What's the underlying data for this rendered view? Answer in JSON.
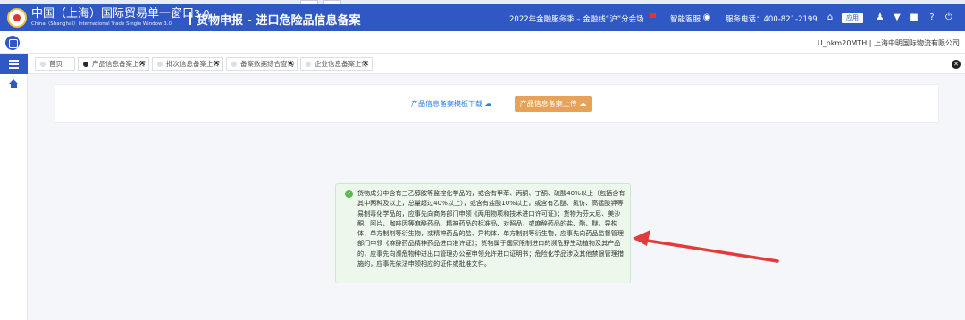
{
  "header": {
    "brand_cn": "中国（上海）国际贸易单一窗口",
    "brand_version": "3.0",
    "brand_en": "China（ShanghaI）International Trade Single Window 3.0",
    "title": "货物申报 - 进口危险品信息备案",
    "promo_text": "2022年金融服务季 – 金融线“沪”分会场",
    "assistant_label": "智能客服",
    "hotline": "服务电话：400-821-2199",
    "apps_label": "应用"
  },
  "subbar": {
    "user": "U_nkm20MTH | 上海中明国际物流有限公司"
  },
  "tabs": [
    {
      "label": "首页",
      "active": false,
      "closable": false
    },
    {
      "label": "产品信息备案上传",
      "active": true,
      "closable": true
    },
    {
      "label": "批次信息备案上传",
      "active": false,
      "closable": true
    },
    {
      "label": "备案数据综合查询",
      "active": false,
      "closable": true
    },
    {
      "label": "企业信息备案上传",
      "active": false,
      "closable": true
    }
  ],
  "main": {
    "template_link": "产品信息备案模板下载",
    "upload_button": "产品信息备案上传"
  },
  "alert": {
    "message": "货物成分中含有三乙醇胺等监控化学品的，或含有甲苯、丙酮、丁酮、硫酸40%以上（包括含有其中两种及以上，总量超过40%以上），或含有盐酸10%以上，或含有乙醚、氯仿、高锰酸钾等易制毒化学品的，应事先向商务部门申领《两用物项和技术进口许可证》；货物为芬太尼、美沙酮、阿片、咖啡因等麻醉药品、精神药品的标准品、对照品，或麻醉药品的盐、酯、醚、异构体、单方制剂等衍生物，或精神药品的盐、异构体、单方制剂等衍生物，应事先向药品监督管理部门申领《麻醉药品精神药品进口准许证》；货物属于国家限制进口的濒危野生动植物及其产品的，应事先向濒危物种进出口管理办公室申领允许进口证明书；危险化学品涉及其他禁限管理措施的，应事先依法申领相应的证件或批准文件。"
  },
  "colors": {
    "header_bg": "#2f58c4",
    "upload_button_bg": "#e8a258",
    "link": "#2f7be0",
    "alert_bg": "#ecf8eb",
    "success": "#57b94f",
    "annotation_arrow": "#e23b3b"
  }
}
